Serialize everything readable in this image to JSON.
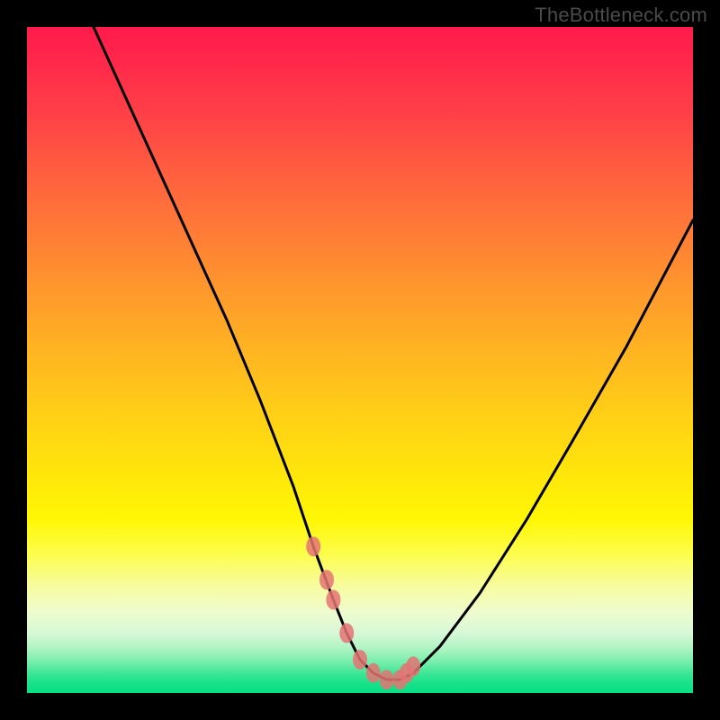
{
  "watermark": "TheBottleneck.com",
  "colors": {
    "marker": "#e57373",
    "curve": "#000000",
    "frame": "#000000"
  },
  "chart_data": {
    "type": "line",
    "title": "",
    "xlabel": "",
    "ylabel": "",
    "xlim": [
      0,
      100
    ],
    "ylim": [
      0,
      100
    ],
    "grid": false,
    "legend": false,
    "series": [
      {
        "name": "bottleneck-curve",
        "x": [
          10,
          15,
          20,
          25,
          30,
          35,
          40,
          43,
          46,
          48,
          50,
          52,
          54,
          56,
          58,
          62,
          68,
          75,
          82,
          90,
          100
        ],
        "y": [
          100,
          89,
          78,
          67,
          56,
          44,
          31,
          22,
          14,
          9,
          5,
          3,
          2,
          2,
          3,
          7,
          15,
          26,
          38,
          52,
          71
        ]
      }
    ],
    "markers": {
      "name": "highlighted-points",
      "x": [
        43,
        45,
        46,
        48,
        50,
        52,
        54,
        56,
        57,
        58
      ],
      "y": [
        22,
        17,
        14,
        9,
        5,
        3,
        2,
        2,
        3,
        4
      ]
    },
    "annotations": []
  }
}
